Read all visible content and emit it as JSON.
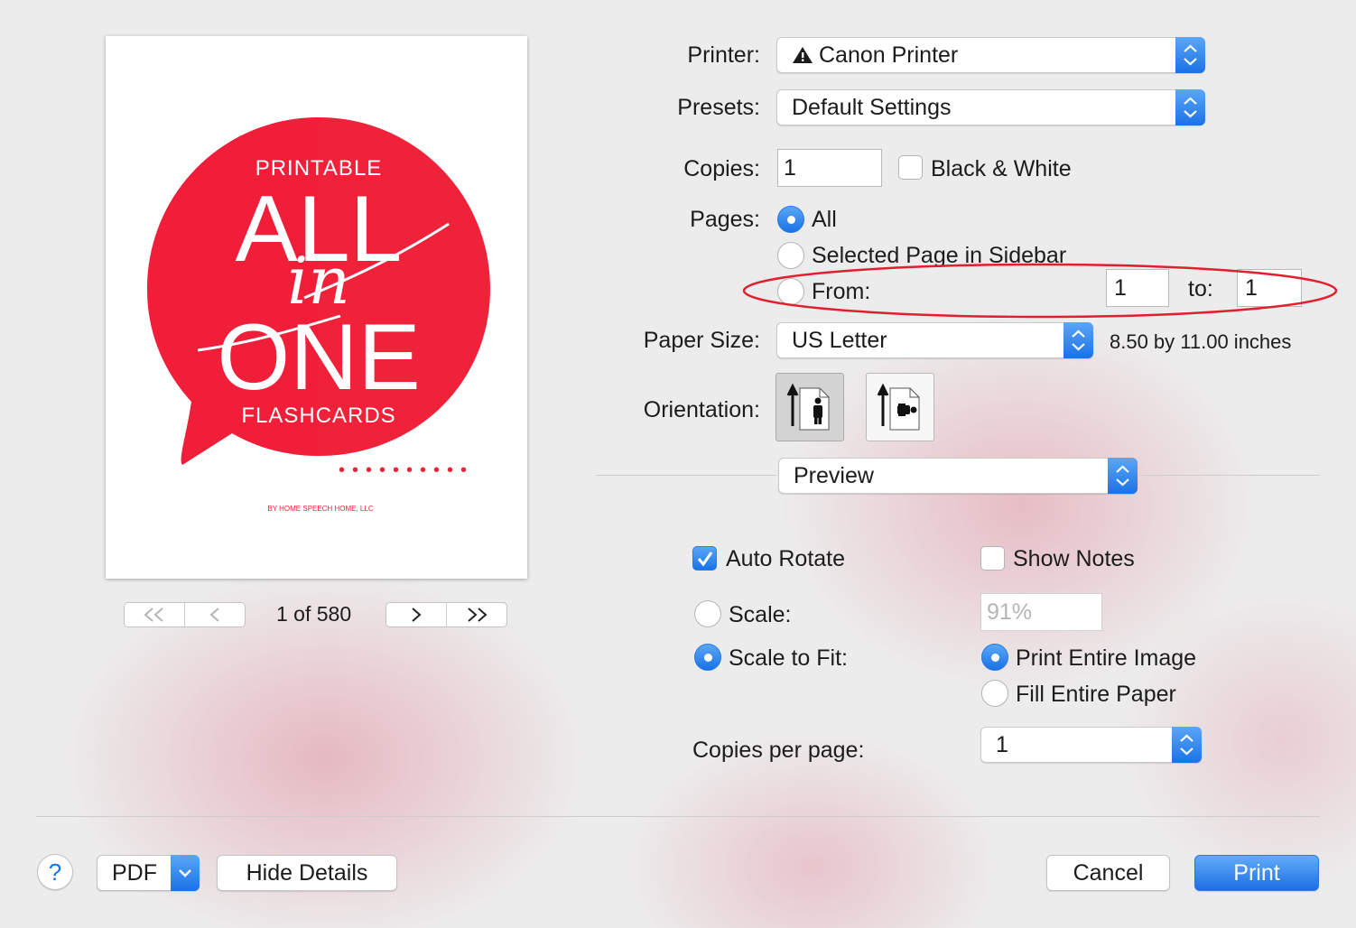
{
  "preview": {
    "cover": {
      "line1": "PRINTABLE",
      "line2": "ALL",
      "line3": "in",
      "line4": "ONE",
      "line5": "FLASHCARDS",
      "byline": "BY HOME SPEECH HOME, LLC",
      "accent_color": "#f0223a"
    },
    "page_counter": "1 of 580"
  },
  "printer": {
    "label": "Printer:",
    "value": "Canon Printer",
    "icon": "warning-icon"
  },
  "presets": {
    "label": "Presets:",
    "value": "Default Settings"
  },
  "copies": {
    "label": "Copies:",
    "value": "1",
    "bw_label": "Black & White",
    "bw_checked": false
  },
  "pages": {
    "label": "Pages:",
    "all_label": "All",
    "selected_label": "Selected Page in Sidebar",
    "from_label": "From:",
    "from_value": "1",
    "to_label": "to:",
    "to_value": "1",
    "selected_option": "All"
  },
  "paper_size": {
    "label": "Paper Size:",
    "value": "US Letter",
    "dimensions": "8.50 by 11.00 inches"
  },
  "orientation": {
    "label": "Orientation:",
    "selected": "portrait"
  },
  "section_popup": {
    "value": "Preview"
  },
  "options": {
    "auto_rotate_label": "Auto Rotate",
    "auto_rotate_checked": true,
    "show_notes_label": "Show Notes",
    "show_notes_checked": false,
    "scale_label": "Scale:",
    "scale_value": "91%",
    "scale_to_fit_label": "Scale to Fit:",
    "print_entire_image_label": "Print Entire Image",
    "fill_entire_paper_label": "Fill Entire Paper",
    "copies_per_page_label": "Copies per page:",
    "copies_per_page_value": "1"
  },
  "footer": {
    "help_label": "?",
    "pdf_label": "PDF",
    "hide_details_label": "Hide Details",
    "cancel_label": "Cancel",
    "print_label": "Print"
  },
  "colors": {
    "accent_blue": "#1a72e6",
    "annotation_red": "#e0202e"
  }
}
